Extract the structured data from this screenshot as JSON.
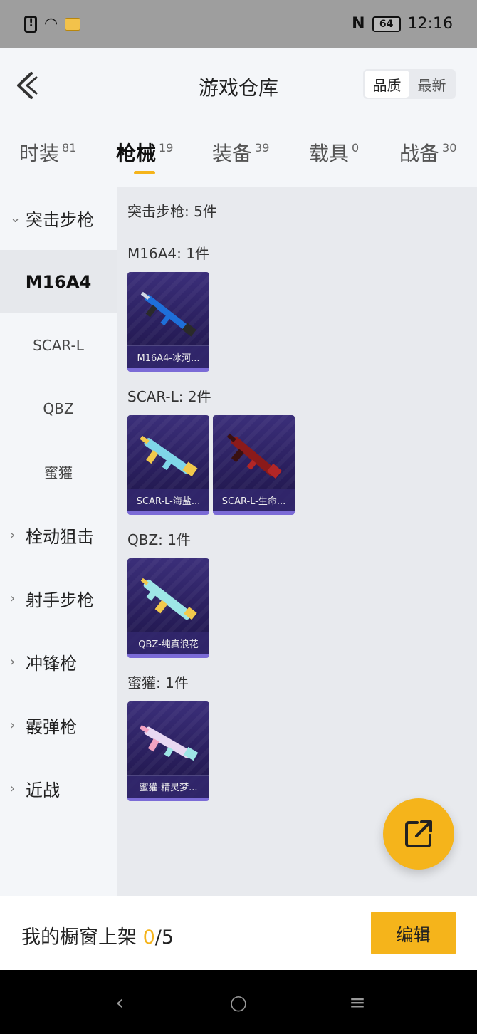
{
  "status_bar": {
    "time": "12:16",
    "battery": "64"
  },
  "header": {
    "title": "游戏仓库",
    "sort_options": [
      "品质",
      "最新"
    ],
    "sort_active": "品质"
  },
  "tabs": [
    {
      "label": "时装",
      "count": "81"
    },
    {
      "label": "枪械",
      "count": "19"
    },
    {
      "label": "装备",
      "count": "39"
    },
    {
      "label": "载具",
      "count": "0"
    },
    {
      "label": "战备",
      "count": "30"
    }
  ],
  "sidebar": {
    "groups": [
      "突击步枪",
      "栓动狙击",
      "射手步枪",
      "冲锋枪",
      "霰弹枪",
      "近战"
    ],
    "subitems": [
      "M16A4",
      "SCAR-L",
      "QBZ",
      "蜜獾"
    ]
  },
  "content": {
    "summary": "突击步枪: 5件",
    "sections": [
      {
        "label": "M16A4: 1件",
        "items": [
          "M16A4-冰河..."
        ]
      },
      {
        "label": "SCAR-L: 2件",
        "items": [
          "SCAR-L-海盐...",
          "SCAR-L-生命..."
        ]
      },
      {
        "label": "QBZ: 1件",
        "items": [
          "QBZ-纯真浪花"
        ]
      },
      {
        "label": "蜜獾: 1件",
        "items": [
          "蜜獾-精灵梦..."
        ]
      }
    ]
  },
  "bottom": {
    "showcase_label": "我的橱窗上架",
    "showcase_count": "0",
    "showcase_total": "/5",
    "edit_label": "编辑"
  },
  "colors": {
    "accent": "#f5b41b",
    "card_bg": "#2a1f5e"
  },
  "icons": {
    "back": "back-arrow-icon",
    "share": "share-external-icon"
  }
}
